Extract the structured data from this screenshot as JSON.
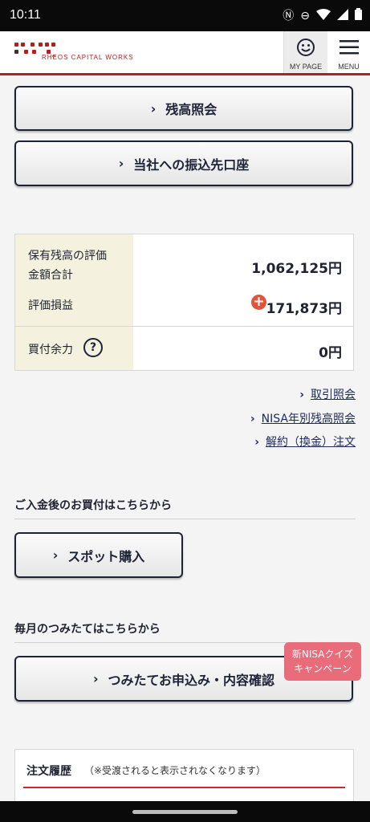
{
  "status": {
    "time": "10:11",
    "icons": [
      "nfc-icon",
      "dnd-icon",
      "wifi-icon",
      "signal-icon",
      "battery-icon"
    ]
  },
  "header": {
    "brand": "RHEOS CAPITAL WORKS",
    "mypage_label": "MY PAGE",
    "menu_label": "MENU",
    "accent": "#b51e1e"
  },
  "buttons": {
    "balance": "残高照会",
    "transfer": "当社への振込先口座",
    "spot": "スポット購入",
    "tsumitate": "つみたてお申込み・内容確認"
  },
  "summary": {
    "eval_label_line1": "保有残高の評価",
    "eval_label_line2": "金額合計",
    "eval_value": "1,062,125円",
    "pl_label": "評価損益",
    "pl_value": "171,873円",
    "buying_power_label": "買付余力",
    "buying_power_value": "0円"
  },
  "links": {
    "transactions": "取引照会",
    "nisa": "NISA年別残高照会",
    "cancel": "解約（換金）注文"
  },
  "sections": {
    "spot_title": "ご入金後のお買付はこちらから",
    "monthly_title": "毎月のつみたてはこちらから"
  },
  "badge": {
    "line1": "新NISAクイズ",
    "line2": "キャンペーン"
  },
  "history": {
    "title": "注文履歴",
    "note": "（※受渡されると表示されなくなります）"
  }
}
